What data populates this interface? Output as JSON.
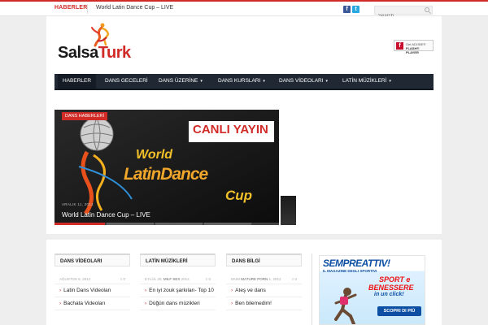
{
  "topbar": {
    "label": "HABERLER",
    "news_text": "World Latin Dance Cup – LIVE",
    "facebook_glyph": "f",
    "twitter_glyph": "t",
    "search_placeholder": "Search..."
  },
  "logo": {
    "word1": "Salsa",
    "word2": "Turk"
  },
  "flash_badge": {
    "icon_glyph": "f",
    "line1": "Get ADOBE®",
    "line2": "FLASH® PLAYER"
  },
  "nav": {
    "items": [
      {
        "label": "HABERLER",
        "has_chevron": false
      },
      {
        "label": "DANS GECELERİ",
        "has_chevron": false
      },
      {
        "label": "DANS ÜZERİNE",
        "has_chevron": true
      },
      {
        "label": "DANS KURSLARI",
        "has_chevron": true
      },
      {
        "label": "DANS VİDEOLARI",
        "has_chevron": true
      },
      {
        "label": "LATİN MÜZİKLERİ",
        "has_chevron": true
      }
    ],
    "chevron_glyph": "▾"
  },
  "slider": {
    "category": "DANS HABERLERİ",
    "banner_text": "CANLI YAYIN",
    "logo_word1": "World",
    "logo_word2": "LatinDance",
    "logo_word3": "Cup",
    "date": "ARALIK 11, 2014",
    "title": "World Latin Dance Cup – LIVE"
  },
  "columns": [
    {
      "heading": "DANS VİDEOLARI",
      "meta_date": "AĞUSTOS 6, 2012",
      "meta_mid": "",
      "meta_count": "0",
      "items": [
        "Latin Dans Videoları",
        "Bachata Videoları"
      ]
    },
    {
      "heading": "LATİN MÜZİKLERİ",
      "meta_date": "EYLÜL 20,",
      "meta_mid": "MILF SEX",
      "meta_date2": "2012",
      "meta_count": "0",
      "items": [
        "En iyi zouk şarkıları- Top 10",
        "Düğün dans müzikleri"
      ]
    },
    {
      "heading": "DANS BİLGİ",
      "meta_date": "EKIM",
      "meta_mid": "MATURE PORN",
      "meta_date2": "1, 2012",
      "meta_count": "0",
      "items": [
        "Ateş ve dans",
        "Ben bilemedim!"
      ]
    }
  ],
  "ad": {
    "brand": "SEMPREATTIV!",
    "sub": "IL MAGAZINE DEGLI SPORTIVI",
    "line1": "SPORT e",
    "line2": "BENESSERE",
    "line3": "in un click!",
    "cta": "SCOPRI DI PIÙ"
  },
  "colors": {
    "accent": "#d12b28",
    "nav_bg": "#1f2833",
    "ad_blue": "#0d4fa3"
  }
}
